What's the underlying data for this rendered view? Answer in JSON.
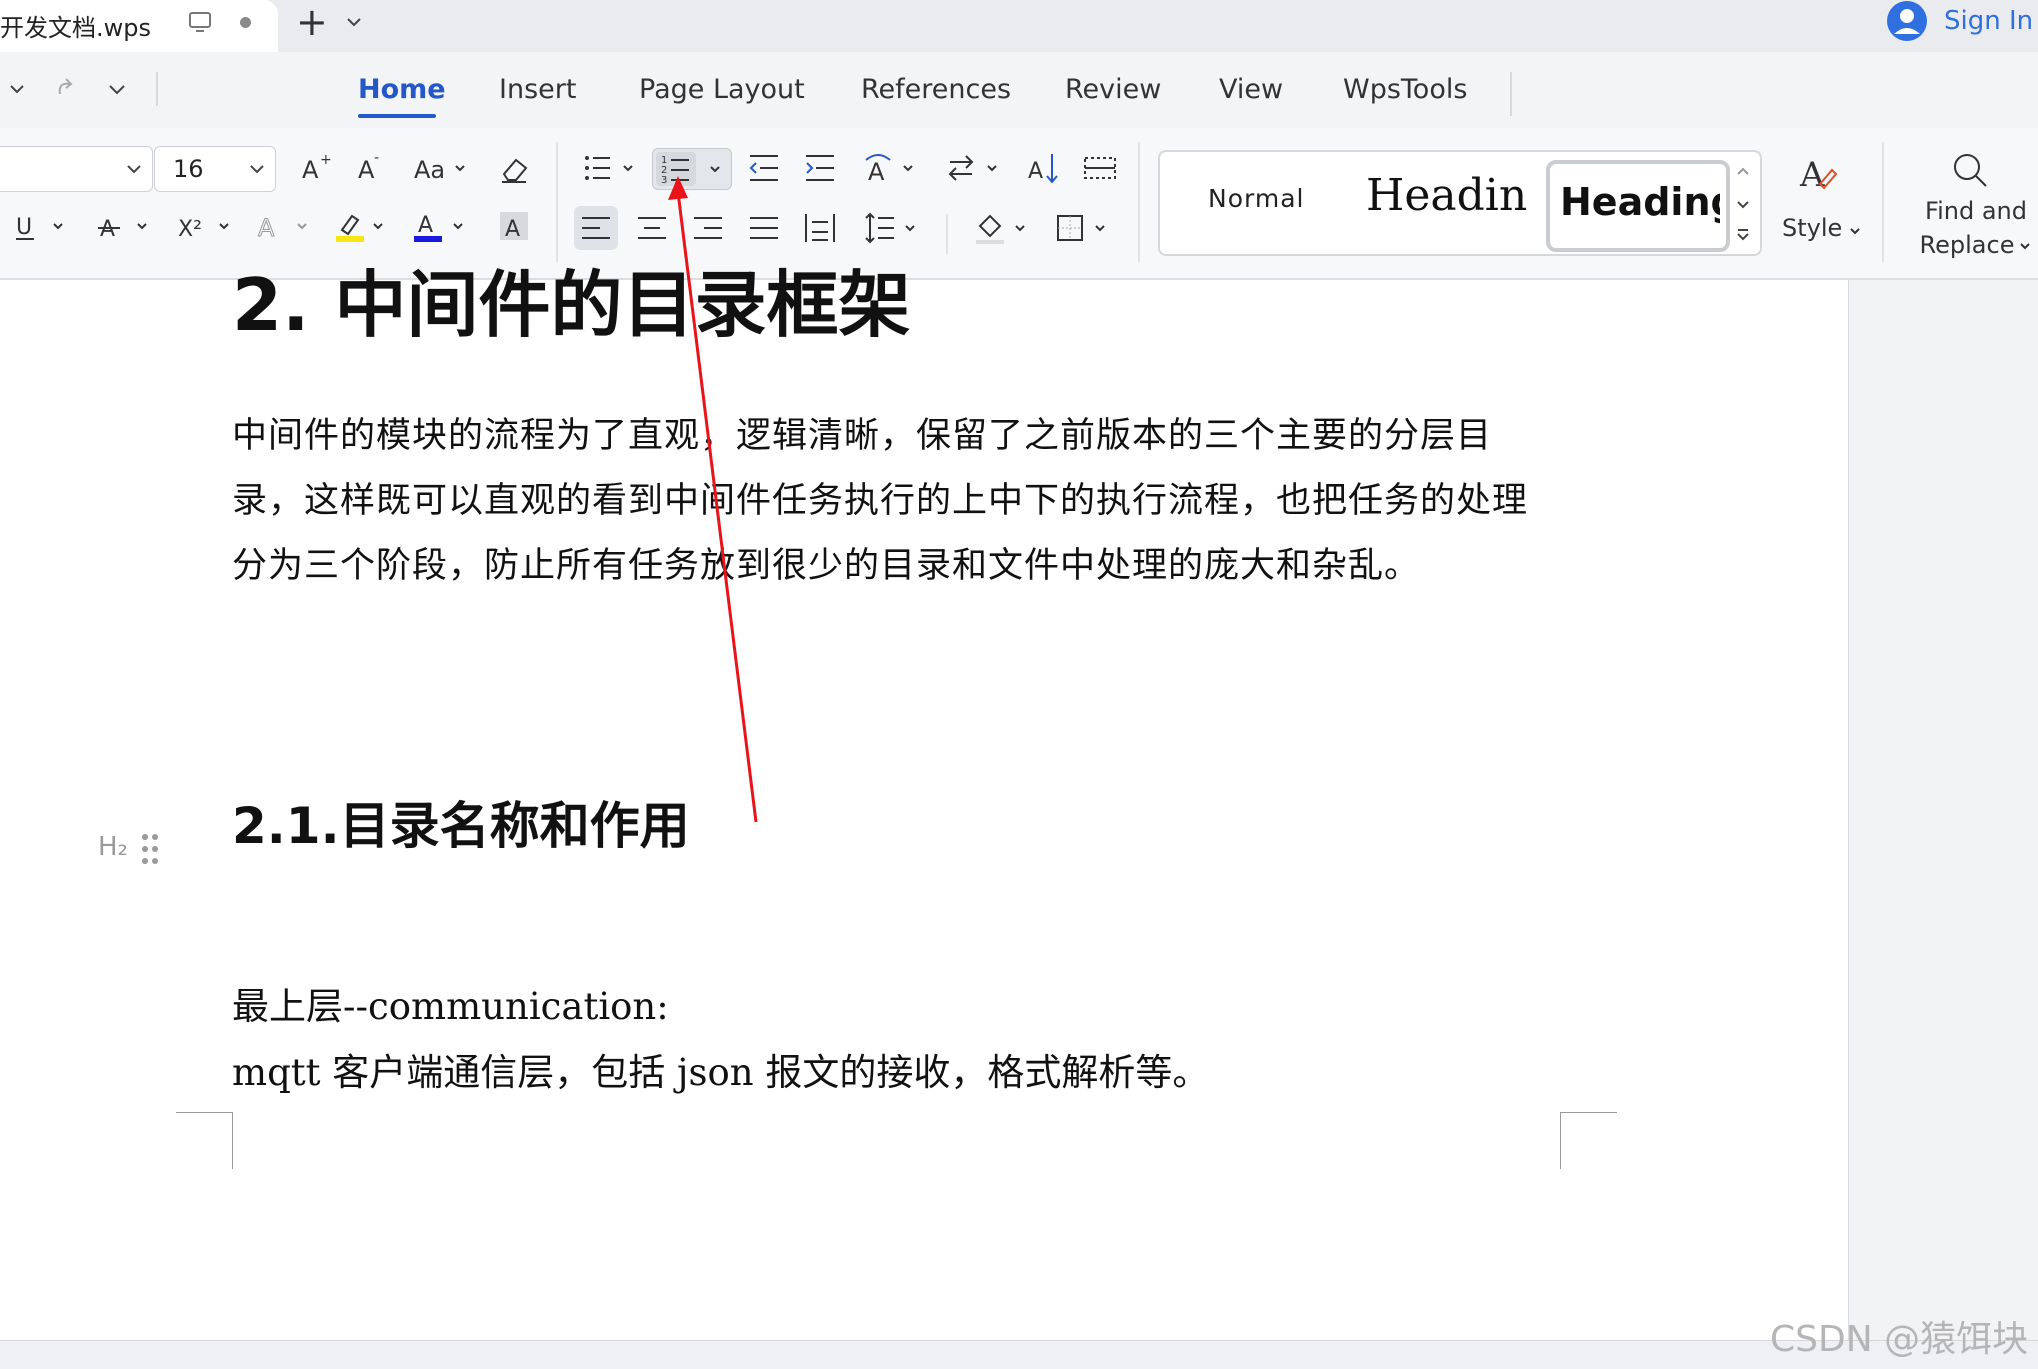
{
  "titlebar": {
    "document_name": "开发文档.wps",
    "new_tab_label": "+",
    "sign_in_label": "Sign In"
  },
  "menu": {
    "tabs": [
      {
        "label": "Home",
        "active": true
      },
      {
        "label": "Insert"
      },
      {
        "label": "Page Layout"
      },
      {
        "label": "References"
      },
      {
        "label": "Review"
      },
      {
        "label": "View"
      },
      {
        "label": "WpsTools"
      }
    ]
  },
  "toolbar": {
    "font_size": "16",
    "styles": {
      "normal": "Normal",
      "heading1": "Heading",
      "heading2": "Heading"
    },
    "style_button_label": "Style",
    "find_replace_label_line1": "Find and",
    "find_replace_label_line2": "Replace",
    "highlight_color": "#f5e614",
    "font_color": "#1a1adf",
    "accent_color": "#2458c8"
  },
  "document": {
    "heading1": "2. 中间件的目录框架",
    "paragraph": "中间件的模块的流程为了直观，逻辑清晰，保留了之前版本的三个主要的分层目录，这样既可以直观的看到中间件任务执行的上中下的执行流程，也把任务的处理分为三个阶段，防止所有任务放到很少的目录和文件中处理的庞大和杂乱。",
    "heading2": "2.1.目录名称和作用",
    "h2_marker": "H₂",
    "line1": "最上层--communication:",
    "line2": "mqtt 客户端通信层，包括 json 报文的接收，格式解析等。"
  },
  "annotation": {
    "arrow_color": "#e8141a",
    "icon": "red-arrow-pointing-to-numbered-list-button"
  },
  "watermark": "CSDN @猿饵块"
}
